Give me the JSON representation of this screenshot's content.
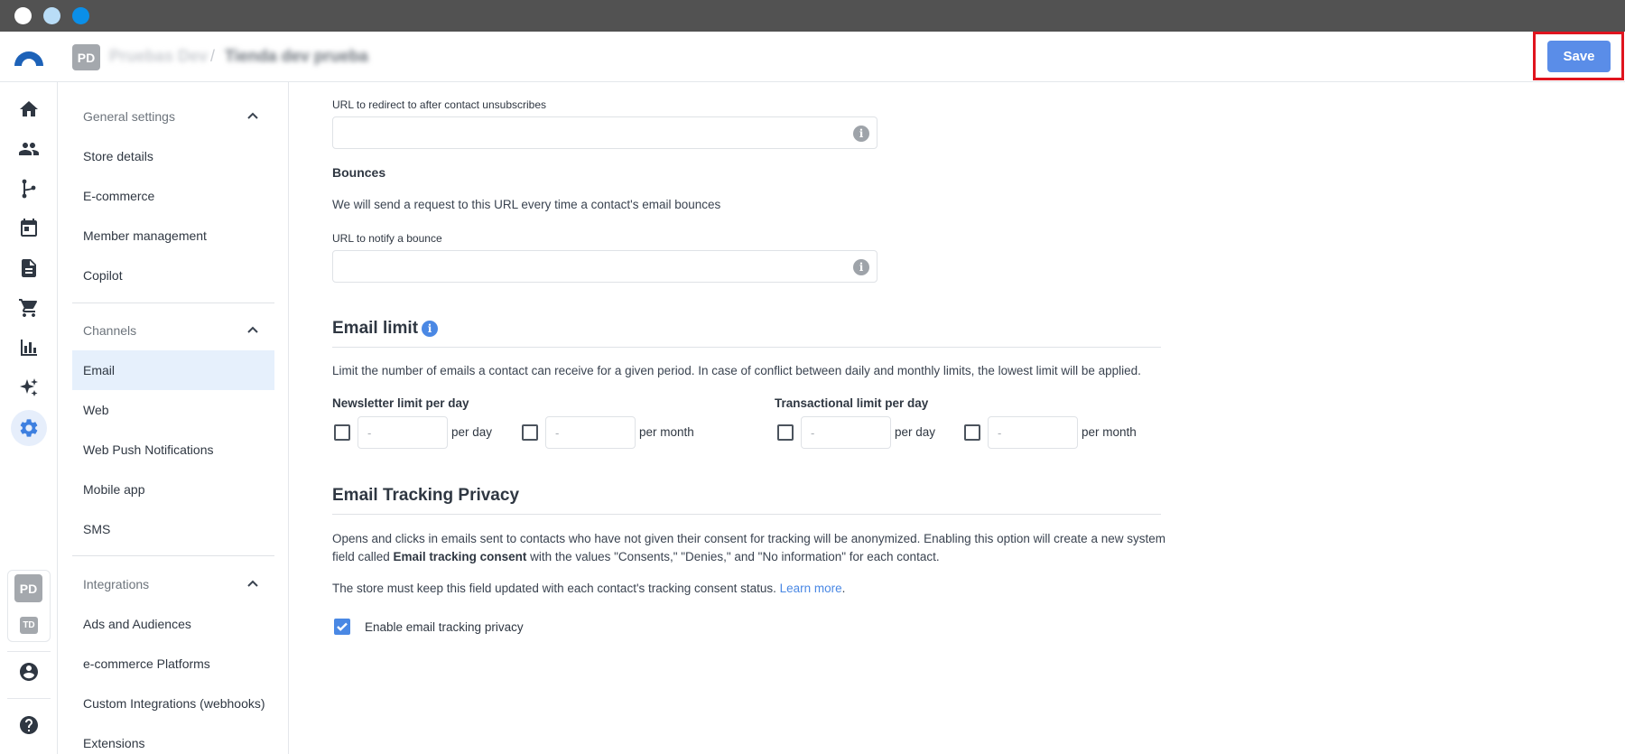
{
  "header": {
    "account_initials": "PD",
    "breadcrumb_org": "Pruebas Dev",
    "breadcrumb_separator": "/",
    "breadcrumb_store": "Tienda dev prueba",
    "save_label": "Save"
  },
  "rail": {
    "icons": [
      "home-icon",
      "contacts-icon",
      "flows-icon",
      "calendar-icon",
      "document-icon",
      "cart-icon",
      "analytics-icon",
      "sparkles-icon",
      "settings-icon",
      "account-icon",
      "help-icon"
    ],
    "org_initials": "PD",
    "store_initials": "TD"
  },
  "menu": {
    "general": {
      "title": "General settings",
      "items": [
        "Store details",
        "E-commerce",
        "Member management",
        "Copilot"
      ]
    },
    "channels": {
      "title": "Channels",
      "items": [
        "Email",
        "Web",
        "Web Push Notifications",
        "Mobile app",
        "SMS"
      ],
      "active": "Email"
    },
    "integrations": {
      "title": "Integrations",
      "items": [
        "Ads and Audiences",
        "e-commerce Platforms",
        "Custom Integrations (webhooks)",
        "Extensions"
      ]
    }
  },
  "content": {
    "unsubscribe_url_label": "URL to redirect to after contact unsubscribes",
    "unsubscribe_url_value": "",
    "bounces_title": "Bounces",
    "bounces_desc": "We will send a request to this URL every time a contact's email bounces",
    "bounce_url_label": "URL to notify a bounce",
    "bounce_url_value": "",
    "email_limit": {
      "title": "Email limit",
      "desc": "Limit the number of emails a contact can receive for a given period. In case of conflict between daily and monthly limits, the lowest limit will be applied.",
      "newsletter_label": "Newsletter limit per day",
      "transactional_label": "Transactional limit per day",
      "placeholder": "-",
      "per_day": "per day",
      "per_month": "per month",
      "newsletter_day_checked": false,
      "newsletter_month_checked": false,
      "transactional_day_checked": false,
      "transactional_month_checked": false
    },
    "tracking": {
      "title": "Email Tracking Privacy",
      "desc_part1": "Opens and clicks in emails sent to contacts who have not given their consent for tracking will be anonymized. Enabling this option will create a new system",
      "desc_part2_prefix": "field called ",
      "desc_bold": "Email tracking consent",
      "desc_part2_suffix": " with the values \"Consents,\" \"Denies,\" and \"No information\" for each contact.",
      "desc2": "The store must keep this field updated with each contact's tracking consent status.",
      "learn_more": "Learn more",
      "learn_more_suffix": ".",
      "enable_label": "Enable email tracking privacy",
      "enable_checked": true
    }
  },
  "colors": {
    "accent": "#5a8de8",
    "highlight": "#e0141e",
    "active_menu_bg": "#e6f0fc"
  }
}
